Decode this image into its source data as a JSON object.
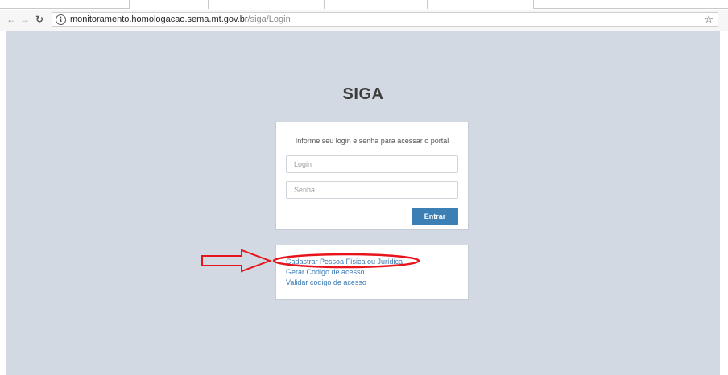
{
  "browser": {
    "url_host": "monitoramento.homologacao.sema.mt.gov.br",
    "url_path": "/siga/Login",
    "icons": [
      "back-icon",
      "forward-icon",
      "reload-icon",
      "info-icon",
      "bookmark-star-icon"
    ]
  },
  "page": {
    "title": "SIGA",
    "login_panel": {
      "hint": "Informe seu login e senha para acessar o portal",
      "login_placeholder": "Login",
      "senha_placeholder": "Senha",
      "entrar_label": "Entrar"
    },
    "links": [
      {
        "label": "Cadastrar Pessoa Física ou Jurídica"
      },
      {
        "label": "Gerar Codigo de acesso"
      },
      {
        "label": "Validar codigo de acesso"
      }
    ]
  },
  "annotation": {
    "color": "#e8141c",
    "highlighted_link": "Cadastrar Pessoa Física ou Jurídica"
  },
  "colors": {
    "background": "#d3d9e2",
    "primary_button": "#3c7fb5",
    "link": "#3a79b2"
  }
}
